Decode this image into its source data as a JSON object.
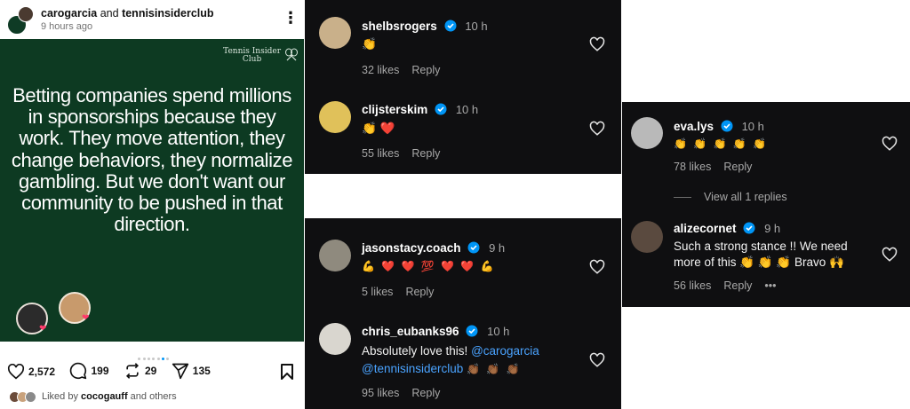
{
  "post": {
    "author": "carogarcia",
    "and": "and",
    "collaborator": "tennisinsiderclub",
    "time": "9 hours ago",
    "brand_line1": "Tennis Insider",
    "brand_line2": "Club",
    "quote": "Betting companies spend millions in sponsorships because they work. They move attention, they change behaviors, they normalize gambling. But we don't want our community to be pushed in that direction.",
    "likes": "2,572",
    "comments": "199",
    "reposts": "29",
    "shares": "135",
    "liked_by_prefix": "Liked by",
    "liked_by_user": "cocogauff",
    "liked_by_suffix": "and others",
    "carousel": {
      "count": 7,
      "active_index": 5
    }
  },
  "comments": [
    {
      "user": "shelbsrogers",
      "time": "10 h",
      "text": "👏",
      "likes": "32 likes",
      "reply": "Reply"
    },
    {
      "user": "clijsterskim",
      "time": "10 h",
      "text": "👏 ❤️",
      "likes": "55 likes",
      "reply": "Reply"
    },
    {
      "user": "jasonstacy.coach",
      "time": "9 h",
      "text": "💪 ❤️ ❤️ 💯 ❤️ ❤️ 💪",
      "likes": "5 likes",
      "reply": "Reply"
    },
    {
      "user": "chris_eubanks96",
      "time": "10 h",
      "text_line1": "Absolutely love this!",
      "mention1": "@carogarcia",
      "mention2": "@tennisinsiderclub",
      "emoji": "👏🏾 👏🏾 👏🏾",
      "likes": "95 likes",
      "reply": "Reply"
    },
    {
      "user": "eva.lys",
      "time": "10 h",
      "text": "👏 👏 👏 👏 👏",
      "likes": "78 likes",
      "reply": "Reply",
      "view_replies": "View all 1 replies"
    },
    {
      "user": "alizecornet",
      "time": "9 h",
      "text_line1": "Such a strong stance !! We need",
      "text_line2": "more of this 👏 👏 👏 Bravo 🙌",
      "likes": "56 likes",
      "reply": "Reply",
      "more": "•••"
    }
  ],
  "colors": {
    "panel_bg": "#0f0f11",
    "post_green": "#0d3a22",
    "verified": "#0095f6",
    "mention": "#4aa3ff",
    "heart": "#ff3b6b"
  }
}
